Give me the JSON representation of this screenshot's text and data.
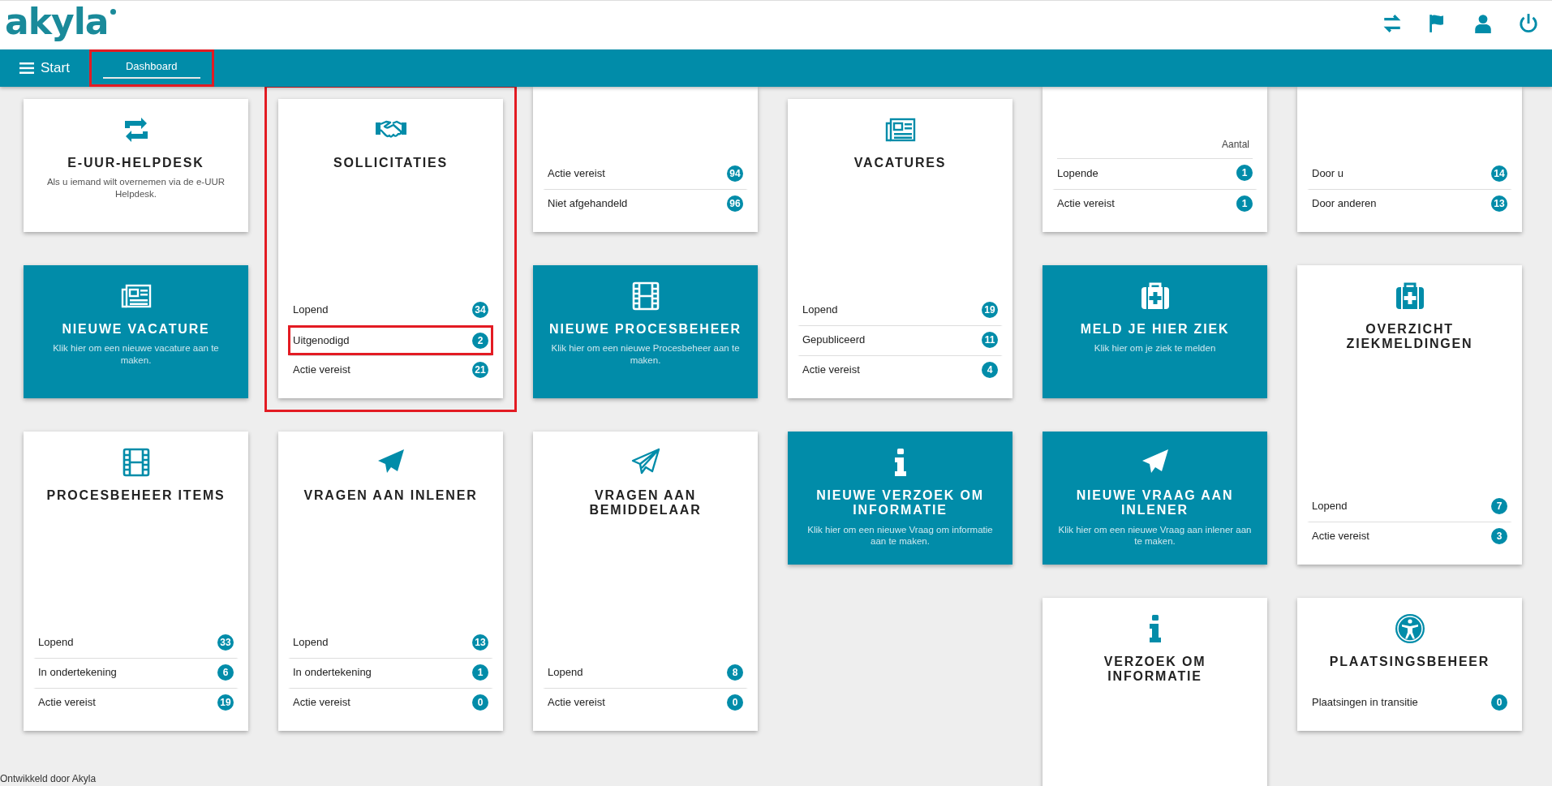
{
  "logo": {
    "text": "akyla"
  },
  "nav": {
    "menu_label": "Start",
    "tabs": [
      {
        "label": "Dashboard",
        "selected": true,
        "highlighted": true
      }
    ]
  },
  "columns": [
    {
      "cards": [
        {
          "kind": "info",
          "title": "E-UUR-HELPDESK",
          "text": "Als u iemand wilt overnemen via de e-UUR Helpdesk.",
          "highlighted": false
        },
        {
          "kind": "action",
          "title": "NIEUWE VACATURE",
          "text": "Klik hier om een nieuwe vacature aan te maken.",
          "highlighted": false
        },
        {
          "kind": "stats",
          "title": "PROCESBEHEER ITEMS",
          "highlighted": false,
          "rows": [
            {
              "label": "Lopend",
              "count": "33",
              "highlighted": false
            },
            {
              "label": "In ondertekening",
              "count": "6",
              "highlighted": false
            },
            {
              "label": "Actie vereist",
              "count": "19",
              "highlighted": false
            }
          ]
        }
      ]
    },
    {
      "cards": [
        {
          "kind": "stats",
          "title": "SOLLICITATIES",
          "highlighted": true,
          "rows": [
            {
              "label": "Lopend",
              "count": "34",
              "highlighted": false
            },
            {
              "label": "Uitgenodigd",
              "count": "2",
              "highlighted": true
            },
            {
              "label": "Actie vereist",
              "count": "21",
              "highlighted": false
            }
          ]
        },
        {
          "kind": "stats",
          "title": "VRAGEN AAN INLENER",
          "highlighted": false,
          "rows": [
            {
              "label": "Lopend",
              "count": "13",
              "highlighted": false
            },
            {
              "label": "In ondertekening",
              "count": "1",
              "highlighted": false
            },
            {
              "label": "Actie vereist",
              "count": "0",
              "highlighted": false
            }
          ]
        }
      ]
    },
    {
      "cards": [
        {
          "kind": "partial",
          "highlighted": false,
          "rows": [
            {
              "label": "Actie vereist",
              "count": "94",
              "highlighted": false
            },
            {
              "label": "Niet afgehandeld",
              "count": "96",
              "highlighted": false
            }
          ]
        },
        {
          "kind": "action",
          "title": "NIEUWE PROCESBEHEER",
          "text": "Klik hier om een nieuwe Procesbeheer aan te maken.",
          "highlighted": false
        },
        {
          "kind": "stats",
          "title": "VRAGEN AAN BEMIDDELAAR",
          "highlighted": false,
          "rows": [
            {
              "label": "Lopend",
              "count": "8",
              "highlighted": false
            },
            {
              "label": "Actie vereist",
              "count": "0",
              "highlighted": false
            }
          ]
        }
      ]
    },
    {
      "cards": [
        {
          "kind": "stats",
          "title": "VACATURES",
          "highlighted": false,
          "rows": [
            {
              "label": "Lopend",
              "count": "19",
              "highlighted": false
            },
            {
              "label": "Gepubliceerd",
              "count": "11",
              "highlighted": false
            },
            {
              "label": "Actie vereist",
              "count": "4",
              "highlighted": false
            }
          ]
        },
        {
          "kind": "action",
          "title": "NIEUWE VERZOEK OM INFORMATIE",
          "text": "Klik hier om een nieuwe Vraag om informatie aan te maken.",
          "highlighted": false
        }
      ]
    },
    {
      "cards": [
        {
          "kind": "partial",
          "header": "Aantal",
          "highlighted": false,
          "rows": [
            {
              "label": "Lopende",
              "count": "1",
              "highlighted": false
            },
            {
              "label": "Actie vereist",
              "count": "1",
              "highlighted": false
            }
          ]
        },
        {
          "kind": "action",
          "title": "MELD JE HIER ZIEK",
          "text": "Klik hier om je ziek te melden",
          "highlighted": false
        },
        {
          "kind": "action",
          "title": "NIEUWE VRAAG AAN INLENER",
          "text": "Klik hier om een nieuwe Vraag aan inlener aan te maken.",
          "highlighted": false
        },
        {
          "kind": "stats",
          "title": "VERZOEK OM INFORMATIE",
          "highlighted": false
        }
      ]
    },
    {
      "cards": [
        {
          "kind": "partial",
          "highlighted": false,
          "rows": [
            {
              "label": "Door u",
              "count": "14",
              "highlighted": false
            },
            {
              "label": "Door anderen",
              "count": "13",
              "highlighted": false
            }
          ]
        },
        {
          "kind": "stats",
          "title": "OVERZICHT ZIEKMELDINGEN",
          "highlighted": false,
          "rows": [
            {
              "label": "Lopend",
              "count": "7",
              "highlighted": false
            },
            {
              "label": "Actie vereist",
              "count": "3",
              "highlighted": false
            }
          ]
        },
        {
          "kind": "info",
          "title": "PLAATSINGSBEHEER",
          "highlighted": false,
          "rows": [
            {
              "label": "Plaatsingen in transitie",
              "count": "0",
              "highlighted": false
            }
          ]
        }
      ]
    }
  ],
  "footer": "Ontwikkeld door Akyla"
}
